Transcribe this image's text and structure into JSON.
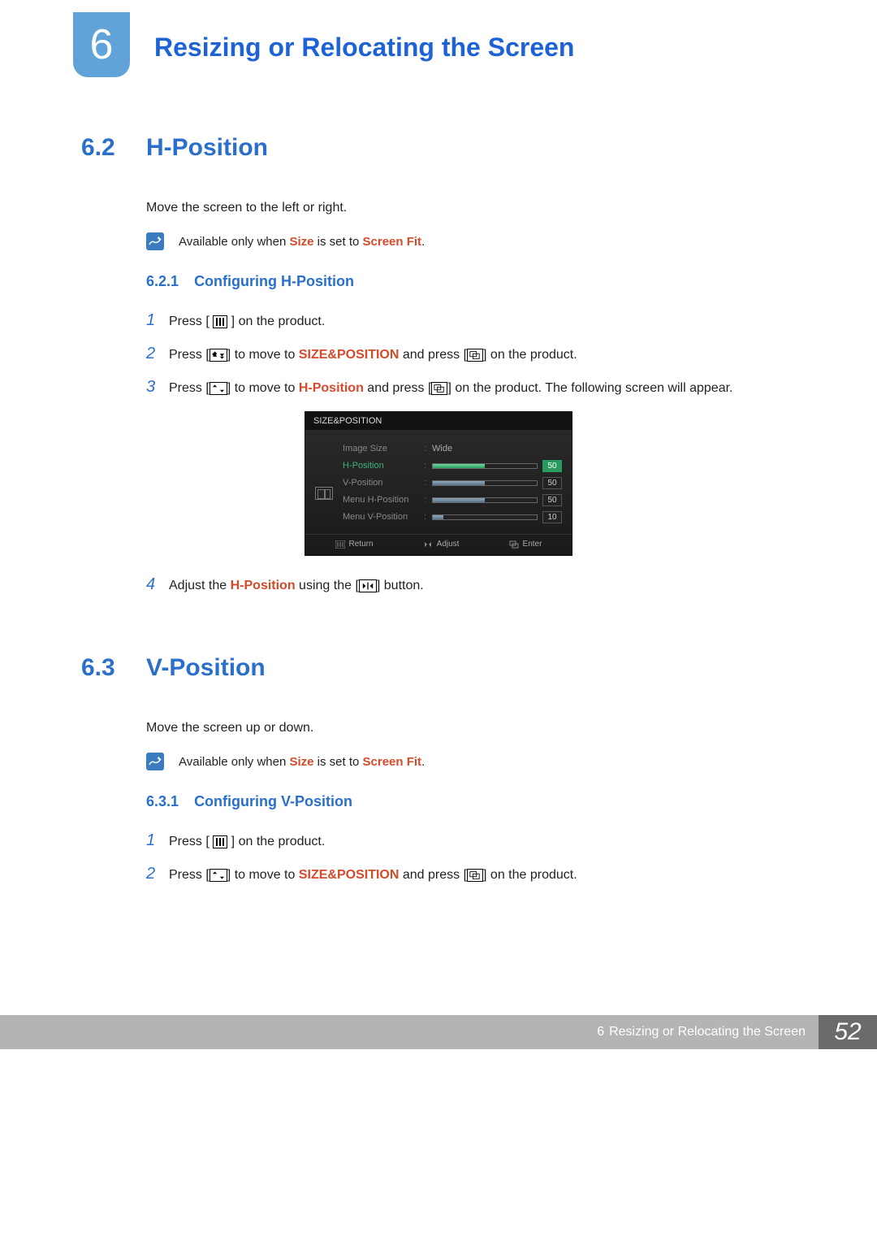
{
  "chapter": {
    "number": "6",
    "title": "Resizing or Relocating the Screen"
  },
  "sections": [
    {
      "num": "6.2",
      "title": "H-Position",
      "intro": "Move the screen to the left or right.",
      "note_prefix": "Available only when ",
      "note_hl1": "Size",
      "note_mid": " is set to ",
      "note_hl2": "Screen Fit",
      "note_suffix": ".",
      "sub_num": "6.2.1",
      "sub_title": "Configuring H-Position",
      "steps": {
        "s1a": "Press [ ",
        "s1b": " ] on the product.",
        "s2a": "Press [",
        "s2b": "] to move to ",
        "s2hl": "SIZE&POSITION",
        "s2c": " and press [",
        "s2d": "] on the product.",
        "s3a": "Press [",
        "s3b": "] to move to ",
        "s3hl": "H-Position",
        "s3c": " and press [",
        "s3d": "] on the product. The following screen will appear.",
        "s4a": "Adjust the ",
        "s4hl": "H-Position",
        "s4b": " using the [",
        "s4c": "] button."
      }
    },
    {
      "num": "6.3",
      "title": "V-Position",
      "intro": "Move the screen up or down.",
      "note_prefix": "Available only when ",
      "note_hl1": "Size",
      "note_mid": " is set to ",
      "note_hl2": "Screen Fit",
      "note_suffix": ".",
      "sub_num": "6.3.1",
      "sub_title": "Configuring V-Position",
      "steps": {
        "s1a": "Press [ ",
        "s1b": " ] on the product.",
        "s2a": "Press [",
        "s2b": "] to move to ",
        "s2hl": "SIZE&POSITION",
        "s2c": " and press [",
        "s2d": "] on the product."
      }
    }
  ],
  "osd": {
    "title": "SIZE&POSITION",
    "rows": {
      "r0": {
        "label": "Image Size",
        "value": "Wide"
      },
      "r1": {
        "label": "H-Position",
        "value": "50",
        "fill": 50
      },
      "r2": {
        "label": "V-Position",
        "value": "50",
        "fill": 50
      },
      "r3": {
        "label": "Menu H-Position",
        "value": "50",
        "fill": 50
      },
      "r4": {
        "label": "Menu V-Position",
        "value": "10",
        "fill": 10
      }
    },
    "footer": {
      "return": "Return",
      "adjust": "Adjust",
      "enter": "Enter"
    }
  },
  "footer": {
    "chapter_num": "6",
    "chapter_title": "Resizing or Relocating the Screen",
    "page": "52"
  }
}
